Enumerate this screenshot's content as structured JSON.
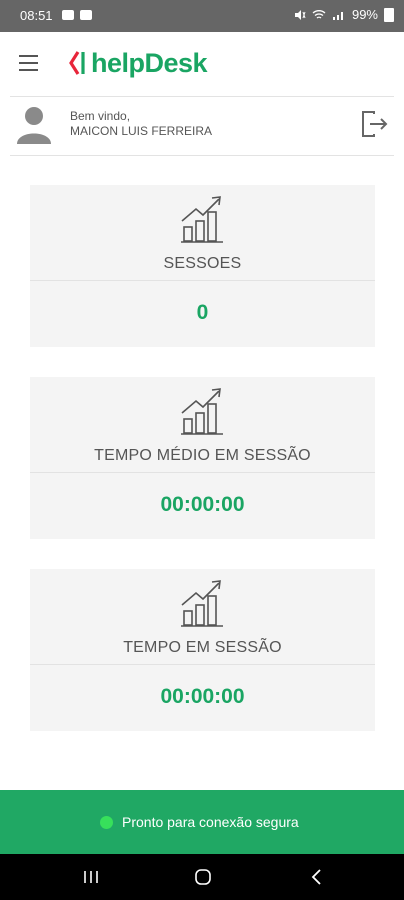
{
  "status_bar": {
    "time": "08:51",
    "battery": "99%",
    "icons": [
      "photo-icon",
      "notification-icon",
      "mute-icon",
      "wifi-icon",
      "volte-icon",
      "signal-icon",
      "battery-icon"
    ]
  },
  "app": {
    "brand": "helpDesk",
    "menu_icon": "hamburger-menu-icon",
    "colors": {
      "accent": "#1aa563",
      "logo_red": "#e8253a",
      "footer": "#20a864"
    }
  },
  "user": {
    "greeting": "Bem vindo,",
    "name": "MAICON LUIS FERREIRA"
  },
  "cards": [
    {
      "icon": "growth-chart-icon",
      "label": "SESSOES",
      "value": "0"
    },
    {
      "icon": "growth-chart-icon",
      "label": "TEMPO MÉDIO EM SESSÃO",
      "value": "00:00:00"
    },
    {
      "icon": "growth-chart-icon",
      "label": "TEMPO EM SESSÃO",
      "value": "00:00:00"
    }
  ],
  "footer": {
    "status_text": "Pronto para conexão segura",
    "status_color": "#37e05b"
  },
  "nav": [
    "recent-apps-icon",
    "home-icon",
    "back-icon"
  ]
}
